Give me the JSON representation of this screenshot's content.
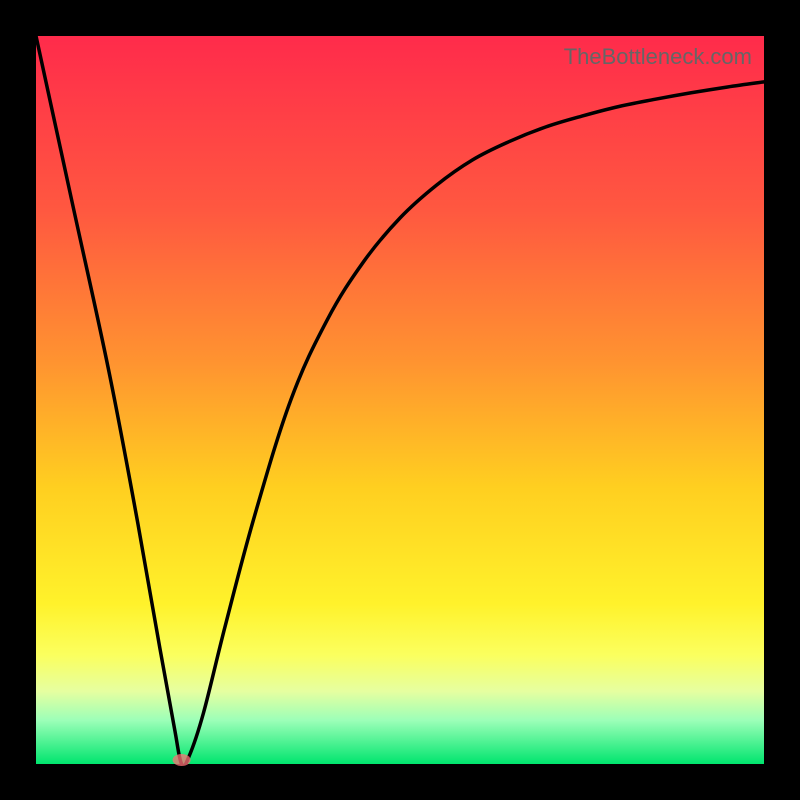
{
  "watermark": "TheBottleneck.com",
  "chart_data": {
    "type": "line",
    "title": "",
    "xlabel": "",
    "ylabel": "",
    "xlim": [
      0,
      100
    ],
    "ylim": [
      0,
      100
    ],
    "grid": false,
    "legend": false,
    "background": "rainbow-vertical-gradient",
    "series": [
      {
        "name": "bottleneck-curve",
        "x": [
          0,
          5,
          10,
          14,
          17,
          19,
          20,
          21,
          23,
          26,
          30,
          35,
          40,
          45,
          50,
          55,
          60,
          65,
          70,
          75,
          80,
          85,
          90,
          95,
          100
        ],
        "y": [
          100,
          77,
          54,
          33,
          16,
          5,
          0,
          1,
          7,
          19,
          34,
          50,
          61,
          69,
          75,
          79.5,
          83,
          85.5,
          87.5,
          89,
          90.3,
          91.3,
          92.2,
          93,
          93.7
        ]
      }
    ],
    "marker": {
      "x": 20,
      "y": 0,
      "color": "#ff6f75"
    }
  },
  "colors": {
    "frame": "#000000",
    "curve": "#000000",
    "marker": "#ff6f75",
    "gradient_stops": [
      "#ff2b4b",
      "#ff5840",
      "#ff9430",
      "#ffcf20",
      "#fff22b",
      "#fbff5e",
      "#e6ffa0",
      "#9cffb8",
      "#00e56e"
    ]
  }
}
